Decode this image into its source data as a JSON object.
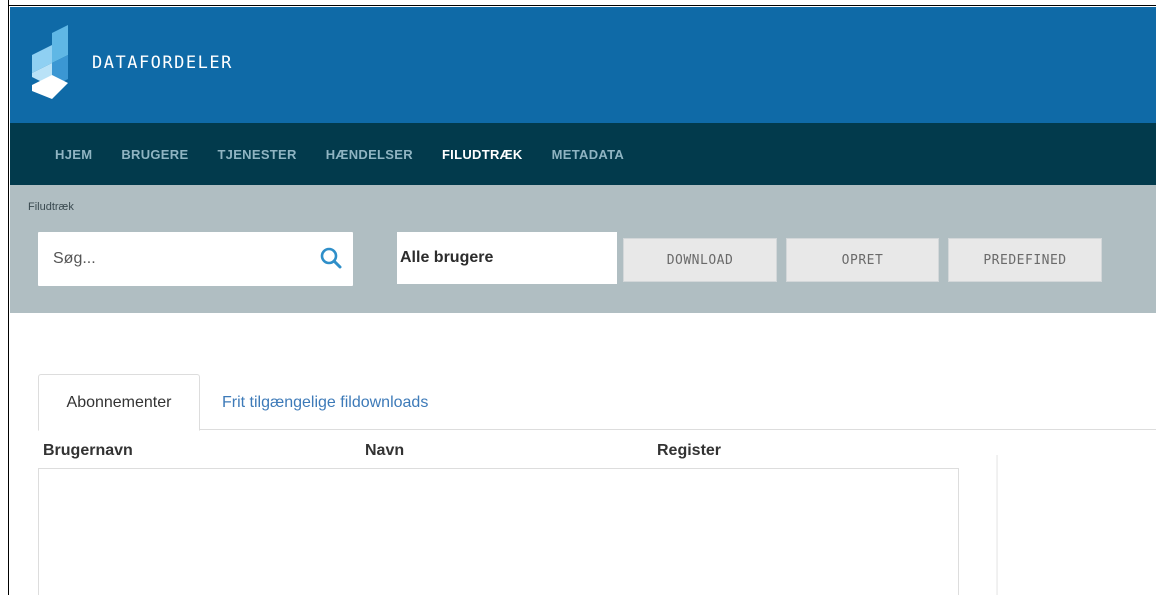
{
  "brand": {
    "name": "DATAFORDELER"
  },
  "nav": {
    "items": [
      {
        "label": "HJEM",
        "active": false
      },
      {
        "label": "BRUGERE",
        "active": false
      },
      {
        "label": "TJENESTER",
        "active": false
      },
      {
        "label": "HÆNDELSER",
        "active": false
      },
      {
        "label": "FILUDTRÆK",
        "active": true
      },
      {
        "label": "METADATA",
        "active": false
      }
    ]
  },
  "toolbar": {
    "breadcrumb": "Filudtræk",
    "search_placeholder": "Søg...",
    "user_select": "Alle brugere",
    "download_label": "DOWNLOAD",
    "opret_label": "OPRET",
    "predefined_label": "PREDEFINED"
  },
  "tabs": {
    "active": "Abonnementer",
    "link": "Frit tilgængelige fildownloads"
  },
  "table": {
    "columns": [
      "Brugernavn",
      "Navn",
      "Register"
    ]
  },
  "colors": {
    "header": "#0f6aa7",
    "nav": "#023a4c",
    "toolbar": "#b0bec2",
    "link": "#3d7ab8",
    "search_icon": "#2f8fc9"
  },
  "icons": {
    "search": "search-icon",
    "logo": "datafordeler-logo-icon"
  }
}
